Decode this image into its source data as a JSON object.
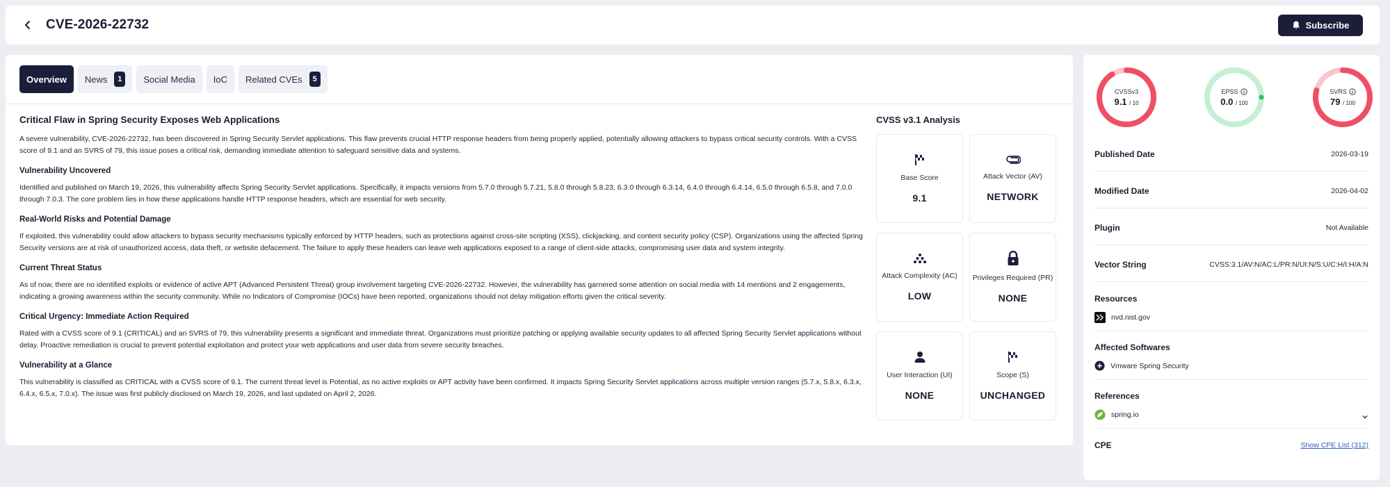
{
  "header": {
    "title": "CVE-2026-22732",
    "subscribe_label": "Subscribe"
  },
  "tabs": [
    {
      "label": "Overview",
      "badge": ""
    },
    {
      "label": "News",
      "badge": "1"
    },
    {
      "label": "Social Media",
      "badge": ""
    },
    {
      "label": "IoC",
      "badge": ""
    },
    {
      "label": "Related CVEs",
      "badge": "5"
    }
  ],
  "article": {
    "title": "Critical Flaw in Spring Security Exposes Web Applications",
    "intro": "A severe vulnerability, CVE-2026-22732, has been discovered in Spring Security Servlet applications. This flaw prevents crucial HTTP response headers from being properly applied, potentially allowing attackers to bypass critical security controls. With a CVSS score of 9.1 and an SVRS of 79, this issue poses a critical risk, demanding immediate attention to safeguard sensitive data and systems.",
    "sections": [
      {
        "heading": "Vulnerability Uncovered",
        "body": "Identified and published on March 19, 2026, this vulnerability affects Spring Security Servlet applications. Specifically, it impacts versions from 5.7.0 through 5.7.21, 5.8.0 through 5.8.23, 6.3.0 through 6.3.14, 6.4.0 through 6.4.14, 6.5.0 through 6.5.8, and 7.0.0 through 7.0.3. The core problem lies in how these applications handle HTTP response headers, which are essential for web security."
      },
      {
        "heading": "Real-World Risks and Potential Damage",
        "body": "If exploited, this vulnerability could allow attackers to bypass security mechanisms typically enforced by HTTP headers, such as protections against cross-site scripting (XSS), clickjacking, and content security policy (CSP). Organizations using the affected Spring Security versions are at risk of unauthorized access, data theft, or website defacement. The failure to apply these headers can leave web applications exposed to a range of client-side attacks, compromising user data and system integrity."
      },
      {
        "heading": "Current Threat Status",
        "body": "As of now, there are no identified exploits or evidence of active APT (Advanced Persistent Threat) group involvement targeting CVE-2026-22732. However, the vulnerability has garnered some attention on social media with 14 mentions and 2 engagements, indicating a growing awareness within the security community. While no Indicators of Compromise (IOCs) have been reported, organizations should not delay mitigation efforts given the critical severity."
      },
      {
        "heading": "Critical Urgency: Immediate Action Required",
        "body": "Rated with a CVSS score of 9.1 (CRITICAL) and an SVRS of 79, this vulnerability presents a significant and immediate threat. Organizations must prioritize patching or applying available security updates to all affected Spring Security Servlet applications without delay. Proactive remediation is crucial to prevent potential exploitation and protect your web applications and user data from severe security breaches."
      },
      {
        "heading": "Vulnerability at a Glance",
        "body": "This vulnerability is classified as CRITICAL with a CVSS score of 9.1. The current threat level is Potential, as no active exploits or APT activity have been confirmed. It impacts Spring Security Servlet applications across multiple version ranges (5.7.x, 5.8.x, 6.3.x, 6.4.x, 6.5.x, 7.0.x). The issue was first publicly disclosed on March 19, 2026, and last updated on April 2, 2026."
      }
    ]
  },
  "cvss": {
    "title": "CVSS v3.1 Analysis",
    "cards": [
      {
        "label": "Base Score",
        "value": "9.1",
        "icon": "flag-icon"
      },
      {
        "label": "Attack Vector (AV)",
        "value": "NETWORK",
        "icon": "paperclip-icon"
      },
      {
        "label": "Attack Complexity (AC)",
        "value": "LOW",
        "icon": "dots-triangle-icon"
      },
      {
        "label": "Privileges Required (PR)",
        "value": "NONE",
        "icon": "lock-icon"
      },
      {
        "label": "User Interaction (UI)",
        "value": "NONE",
        "icon": "user-icon"
      },
      {
        "label": "Scope (S)",
        "value": "UNCHANGED",
        "icon": "flag-icon"
      }
    ]
  },
  "gauges": [
    {
      "name": "CVSSv3",
      "score": "9.1",
      "max": "/ 10",
      "fraction": 0.91,
      "color": "#f04f63",
      "track": "#f8c7cd",
      "info": false
    },
    {
      "name": "EPSS",
      "score": "0.0",
      "max": "/ 100",
      "fraction": 0.0,
      "color": "#2fbf5e",
      "track": "#c5efd2",
      "info": true
    },
    {
      "name": "SVRS",
      "score": "79",
      "max": "/ 100",
      "fraction": 0.79,
      "color": "#f04f63",
      "track": "#f8c7cd",
      "info": true
    }
  ],
  "details": {
    "published_label": "Published Date",
    "published_value": "2026-03-19",
    "modified_label": "Modified Date",
    "modified_value": "2026-04-02",
    "plugin_label": "Plugin",
    "plugin_value": "Not Available",
    "vector_label": "Vector String",
    "vector_value": "CVSS:3.1/AV:N/AC:L/PR:N/UI:N/S:U/C:H/I:H/A:N",
    "resources_label": "Resources",
    "resource_item": "nvd.nist.gov",
    "affected_label": "Affected Softwares",
    "affected_item": "Vmware Spring Security",
    "references_label": "References",
    "reference_item": "spring.io",
    "cpe_label": "CPE",
    "cpe_link": "Show CPE List (312)"
  },
  "colors": {
    "dark": "#1b1e3b",
    "danger": "#f04f63",
    "success": "#2fbf5e",
    "link": "#2d5fb8"
  }
}
